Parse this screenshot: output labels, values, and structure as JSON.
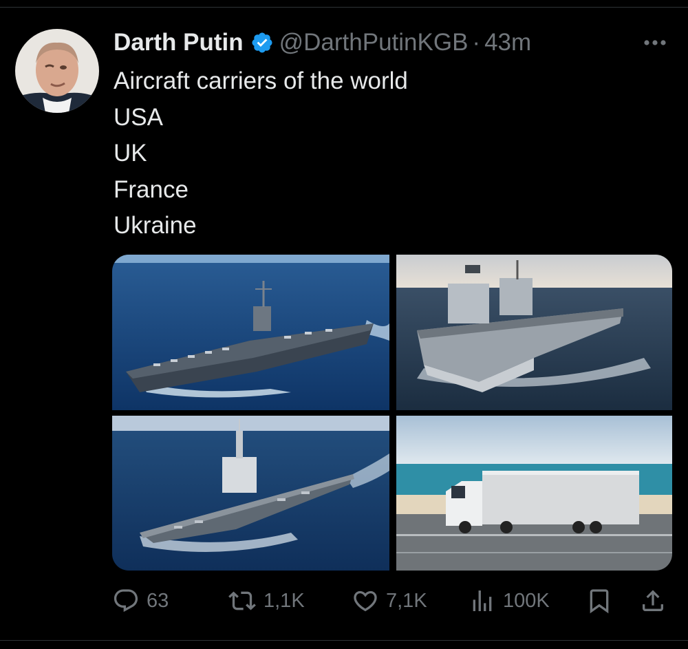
{
  "author": {
    "name": "Darth Putin",
    "handle": "@DarthPutinKGB",
    "separator": "·",
    "time": "43m"
  },
  "tweet": {
    "lines": [
      "Aircraft carriers of the world",
      "USA",
      "UK",
      "France",
      "Ukraine"
    ]
  },
  "media": [
    {
      "subject": "USA aircraft carrier at sea"
    },
    {
      "subject": "UK aircraft carrier at sea"
    },
    {
      "subject": "France aircraft carrier at sea"
    },
    {
      "subject": "White truck on a road by the sea"
    }
  ],
  "actions": {
    "replies": "63",
    "reposts": "1,1K",
    "likes": "7,1K",
    "views": "100K"
  },
  "colors": {
    "background": "#000000",
    "text": "#e7e9ea",
    "secondary": "#71767b",
    "verified": "#1d9bf0",
    "divider": "#2f3336"
  },
  "icons": [
    "verified-badge-icon",
    "more-icon",
    "reply-icon",
    "repost-icon",
    "like-icon",
    "views-icon",
    "bookmark-icon",
    "share-icon"
  ]
}
